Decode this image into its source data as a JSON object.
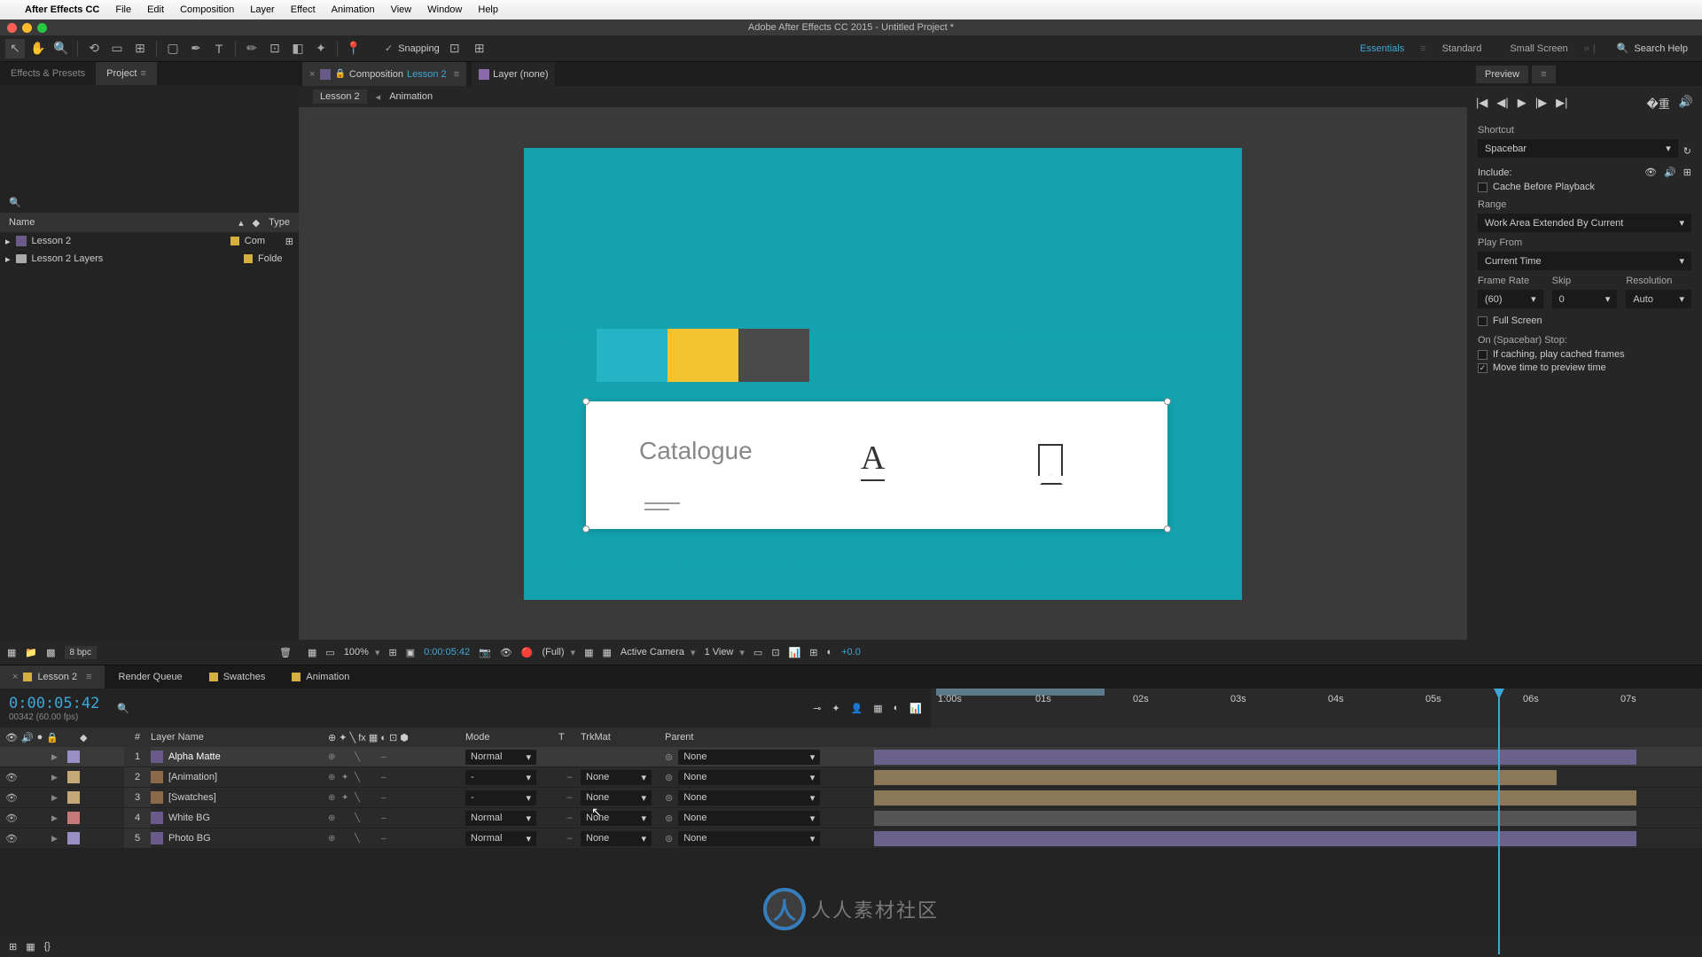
{
  "menubar": {
    "app": "After Effects CC",
    "items": [
      "File",
      "Edit",
      "Composition",
      "Layer",
      "Effect",
      "Animation",
      "View",
      "Window",
      "Help"
    ]
  },
  "window_title": "Adobe After Effects CC 2015 - Untitled Project *",
  "snapping": "Snapping",
  "workspaces": {
    "essentials": "Essentials",
    "standard": "Standard",
    "small": "Small Screen"
  },
  "search_help": "Search Help",
  "panels": {
    "effects": "Effects & Presets",
    "project": "Project"
  },
  "project": {
    "col_name": "Name",
    "col_type": "Type",
    "items": [
      {
        "name": "Lesson 2",
        "type": "Com"
      },
      {
        "name": "Lesson 2 Layers",
        "type": "Folde"
      }
    ],
    "bpc": "8 bpc"
  },
  "comp": {
    "tab_prefix": "Composition",
    "tab_name": "Lesson 2",
    "layer_tab": "Layer (none)",
    "crumb1": "Lesson 2",
    "crumb2": "Animation",
    "card_text": "Catalogue"
  },
  "viewer_footer": {
    "zoom": "100%",
    "time": "0:00:05:42",
    "res": "(Full)",
    "camera": "Active Camera",
    "view": "1 View",
    "exposure": "+0.0"
  },
  "preview": {
    "title": "Preview",
    "shortcut_label": "Shortcut",
    "shortcut": "Spacebar",
    "include": "Include:",
    "cache": "Cache Before Playback",
    "range_label": "Range",
    "range": "Work Area Extended By Current",
    "playfrom_label": "Play From",
    "playfrom": "Current Time",
    "fr_label": "Frame Rate",
    "skip_label": "Skip",
    "res_label": "Resolution",
    "fr": "(60)",
    "skip": "0",
    "res": "Auto",
    "fullscreen": "Full Screen",
    "onstop": "On (Spacebar) Stop:",
    "opt1": "If caching, play cached frames",
    "opt2": "Move time to preview time"
  },
  "timeline": {
    "tabs": {
      "main": "Lesson 2",
      "render": "Render Queue",
      "swatches": "Swatches",
      "animation": "Animation"
    },
    "timecode": "0:00:05:42",
    "tc_sub": "00342 (60.00 fps)",
    "cols": {
      "num": "#",
      "name": "Layer Name",
      "mode": "Mode",
      "t": "T",
      "trkmat": "TrkMat",
      "parent": "Parent"
    },
    "ruler": [
      "1:00s",
      "01s",
      "02s",
      "03s",
      "04s",
      "05s",
      "06s",
      "07s"
    ],
    "layers": [
      {
        "n": "1",
        "name": "Alpha Matte",
        "mode": "Normal",
        "trkmat": "",
        "parent": "None",
        "sel": true,
        "lbl": "lav",
        "eye": false
      },
      {
        "n": "2",
        "name": "[Animation]",
        "mode": "-",
        "trkmat": "None",
        "parent": "None",
        "sel": false,
        "lbl": "tan",
        "eye": true
      },
      {
        "n": "3",
        "name": "[Swatches]",
        "mode": "-",
        "trkmat": "None",
        "parent": "None",
        "sel": false,
        "lbl": "tan",
        "eye": true
      },
      {
        "n": "4",
        "name": "White BG",
        "mode": "Normal",
        "trkmat": "None",
        "parent": "None",
        "sel": false,
        "lbl": "red",
        "eye": true
      },
      {
        "n": "5",
        "name": "Photo BG",
        "mode": "Normal",
        "trkmat": "None",
        "parent": "None",
        "sel": false,
        "lbl": "lav",
        "eye": true
      }
    ]
  },
  "watermark": {
    "initial": "人",
    "text": "人人素材社区"
  }
}
